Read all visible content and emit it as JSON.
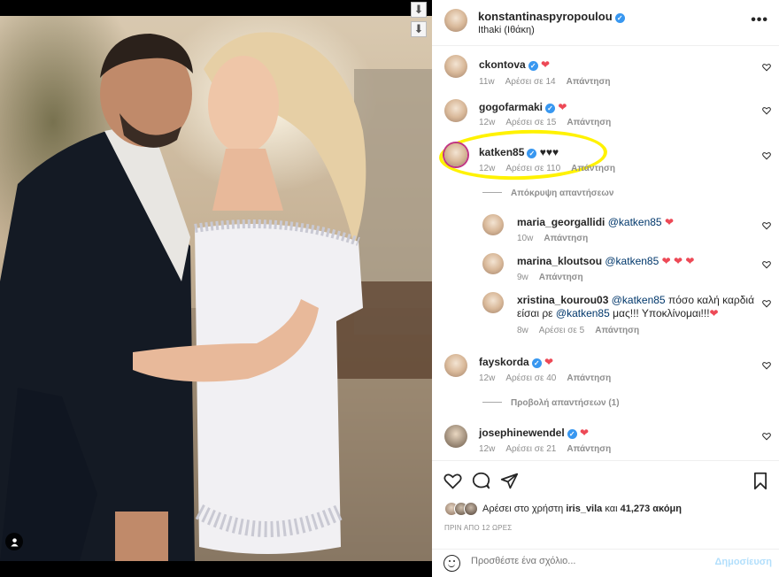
{
  "post": {
    "author": "konstantinaspyropoulou",
    "location": "Ithaki (Ιθάκη)",
    "more_icon": "more-horizontal-icon"
  },
  "comments": [
    {
      "user": "ckontova",
      "text": "",
      "emoji": "❤",
      "time": "11w",
      "likes": "Αρέσει σε 14",
      "reply": "Απάντηση"
    },
    {
      "user": "gogofarmaki",
      "text": "",
      "emoji": "❤",
      "time": "12w",
      "likes": "Αρέσει σε 15",
      "reply": "Απάντηση"
    },
    {
      "user": "katken85",
      "text": "♥♥♥",
      "emoji": "",
      "time": "12w",
      "likes": "Αρέσει σε 110",
      "reply": "Απάντηση",
      "toggle": "Απόκρυψη απαντήσεων",
      "replies": [
        {
          "user": "maria_georgallidi",
          "mention": "@katken85",
          "text": "",
          "emoji": "❤",
          "time": "10w",
          "reply": "Απάντηση"
        },
        {
          "user": "marina_kloutsou",
          "mention": "@katken85",
          "text": "",
          "emoji": "❤ ❤ ❤",
          "time": "9w",
          "reply": "Απάντηση"
        },
        {
          "user": "xristina_kourou03",
          "mention": "@katken85",
          "text": "πόσο καλή καρδιά",
          "line2_prefix": "είσαι ρε",
          "mention2": "@katken85",
          "line2_suffix": "μας!!! Υποκλίνομαι!!!",
          "emoji": "❤",
          "time": "8w",
          "likes": "Αρέσει σε 5",
          "reply": "Απάντηση"
        }
      ]
    },
    {
      "user": "fayskorda",
      "text": "",
      "emoji": "❤",
      "time": "12w",
      "likes": "Αρέσει σε 40",
      "reply": "Απάντηση",
      "toggle": "Προβολή απαντήσεων (1)"
    },
    {
      "user": "josephinewendel",
      "text": "",
      "emoji": "❤",
      "time": "12w",
      "likes": "Αρέσει σε 21",
      "reply": "Απάντηση"
    }
  ],
  "actions": {
    "liked_by_prefix": "Αρέσει στο χρήστη",
    "liked_by_user": "iris_vila",
    "liked_by_and": "και",
    "liked_by_count": "41,273 ακόμη",
    "time_ago": "ΠΡΙΝ ΑΠΟ 12 ΩΡΕΣ"
  },
  "add_comment": {
    "placeholder": "Προσθέστε ένα σχόλιο...",
    "post_label": "Δημοσίευση"
  },
  "colors": {
    "verified": "#3897f0",
    "heart": "#ed4956",
    "highlight": "#fff200"
  }
}
